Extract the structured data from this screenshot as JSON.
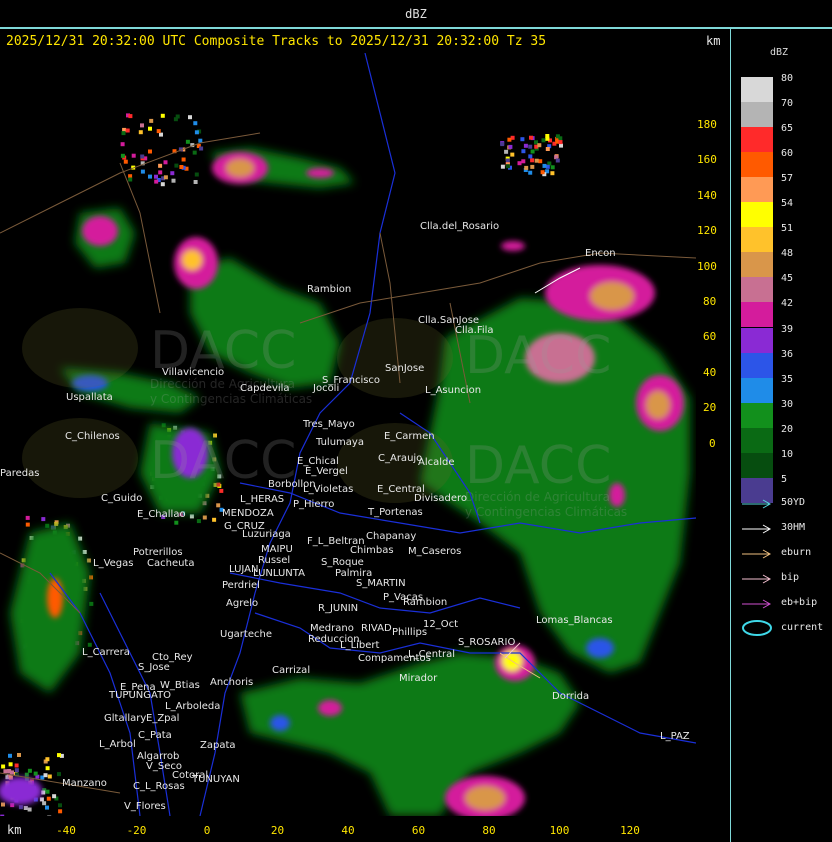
{
  "top_title": "dBZ",
  "header": "2025/12/31 20:32:00 UTC Composite Tracks to 2025/12/31 20:32:00 Tz 35",
  "km_label": "km",
  "y_ticks": [
    "180",
    "160",
    "140",
    "120",
    "100",
    "80",
    "60",
    "40",
    "20",
    "0"
  ],
  "x_ticks": [
    "-40",
    "-20",
    "0",
    "20",
    "40",
    "60",
    "80",
    "100",
    "120"
  ],
  "legend": {
    "title": "dBZ",
    "levels": [
      {
        "label": "80",
        "color": "#d8d8d8"
      },
      {
        "label": "70",
        "color": "#b4b4b4"
      },
      {
        "label": "65",
        "color": "#ff2a2a"
      },
      {
        "label": "60",
        "color": "#ff5a00"
      },
      {
        "label": "57",
        "color": "#ff9a55"
      },
      {
        "label": "54",
        "color": "#ffff00"
      },
      {
        "label": "51",
        "color": "#ffc22b"
      },
      {
        "label": "48",
        "color": "#d9964a"
      },
      {
        "label": "45",
        "color": "#c87092"
      },
      {
        "label": "42",
        "color": "#d41c9c"
      },
      {
        "label": "39",
        "color": "#8a2ad4"
      },
      {
        "label": "36",
        "color": "#2c55e8"
      },
      {
        "label": "35",
        "color": "#1f8ce8"
      },
      {
        "label": "30",
        "color": "#12901c"
      },
      {
        "label": "20",
        "color": "#0a6a14"
      },
      {
        "label": "10",
        "color": "#064d0f"
      },
      {
        "label": "5",
        "color": "#4a3c90"
      }
    ],
    "tracks": [
      {
        "label": "50YD",
        "color": "#58d8e0"
      },
      {
        "label": "30HM",
        "color": "#ffffff"
      },
      {
        "label": "eburn",
        "color": "#f0c080"
      },
      {
        "label": "bip",
        "color": "#f5c0d0"
      },
      {
        "label": "eb+bip",
        "color": "#d050d0"
      },
      {
        "label": "current",
        "color": "#3fd8e8"
      }
    ]
  },
  "watermark": {
    "brand": "DACC",
    "line1": "Dirección de Agricultura",
    "line2": "y Contingencias Climáticas"
  },
  "places": [
    {
      "name": "Clla.del_Rosario"
    },
    {
      "name": "Encon"
    },
    {
      "name": "Rambion"
    },
    {
      "name": "Clla.SanJose"
    },
    {
      "name": "Clla.Fila"
    },
    {
      "name": "Villavicencio"
    },
    {
      "name": "Capdevila"
    },
    {
      "name": "S_Francisco"
    },
    {
      "name": "SanJose"
    },
    {
      "name": "L_Asuncion"
    },
    {
      "name": "Uspallata"
    },
    {
      "name": "Jocoli"
    },
    {
      "name": "Tres_Mayo"
    },
    {
      "name": "E_Carmen"
    },
    {
      "name": "C_Chilenos"
    },
    {
      "name": "Tulumaya"
    },
    {
      "name": "E_Chical"
    },
    {
      "name": "C_Araujo"
    },
    {
      "name": "Alcalde"
    },
    {
      "name": "E_Vergel"
    },
    {
      "name": "Paredas"
    },
    {
      "name": "Borbollon"
    },
    {
      "name": "L_Violetas"
    },
    {
      "name": "E_Central"
    },
    {
      "name": "Divisadero"
    },
    {
      "name": "C_Guido"
    },
    {
      "name": "L_HERAS"
    },
    {
      "name": "P_Hierro"
    },
    {
      "name": "T_Portenas"
    },
    {
      "name": "MENDOZA"
    },
    {
      "name": "E_Challao"
    },
    {
      "name": "G_CRUZ"
    },
    {
      "name": "Luzuriaga"
    },
    {
      "name": "Chapanay"
    },
    {
      "name": "F_L_Beltran"
    },
    {
      "name": "MAIPU"
    },
    {
      "name": "Chimbas"
    },
    {
      "name": "M_Caseros"
    },
    {
      "name": "Potrerillos"
    },
    {
      "name": "Russel"
    },
    {
      "name": "L_Vegas"
    },
    {
      "name": "Cacheuta"
    },
    {
      "name": "S_Roque"
    },
    {
      "name": "LUJAN"
    },
    {
      "name": "LUNLUNTA"
    },
    {
      "name": "Palmira"
    },
    {
      "name": "Perdriel"
    },
    {
      "name": "S_MARTIN"
    },
    {
      "name": "P_Vacas"
    },
    {
      "name": "Agrelo"
    },
    {
      "name": "Rambion"
    },
    {
      "name": "R_JUNIN"
    },
    {
      "name": "Ugarteche"
    },
    {
      "name": "12_Oct"
    },
    {
      "name": "Medrano"
    },
    {
      "name": "RIVAD"
    },
    {
      "name": "Phillips"
    },
    {
      "name": "Lomas_Blancas"
    },
    {
      "name": "Reduccion"
    },
    {
      "name": "S_ROSARIO"
    },
    {
      "name": "L_Carrera"
    },
    {
      "name": "Cto_Rey"
    },
    {
      "name": "L_Libert"
    },
    {
      "name": "Compamentos"
    },
    {
      "name": "L_Central"
    },
    {
      "name": "S_Jose"
    },
    {
      "name": "Carrizal"
    },
    {
      "name": "Mirador"
    },
    {
      "name": "Anchoris"
    },
    {
      "name": "W_Btias"
    },
    {
      "name": "E_Pena"
    },
    {
      "name": "TUPUNGATO"
    },
    {
      "name": "Dorrida"
    },
    {
      "name": "L_Arboleda"
    },
    {
      "name": "Gltallary"
    },
    {
      "name": "E_Zpal"
    },
    {
      "name": "L_PAZ"
    },
    {
      "name": "C_Pata"
    },
    {
      "name": "L_Arbol"
    },
    {
      "name": "Zapata"
    },
    {
      "name": "Algarrob"
    },
    {
      "name": "V_Seco"
    },
    {
      "name": "Cotoral"
    },
    {
      "name": "TUNUYAN"
    },
    {
      "name": "Manzano"
    },
    {
      "name": "C_L_Rosas"
    },
    {
      "name": "V_Flores"
    }
  ]
}
